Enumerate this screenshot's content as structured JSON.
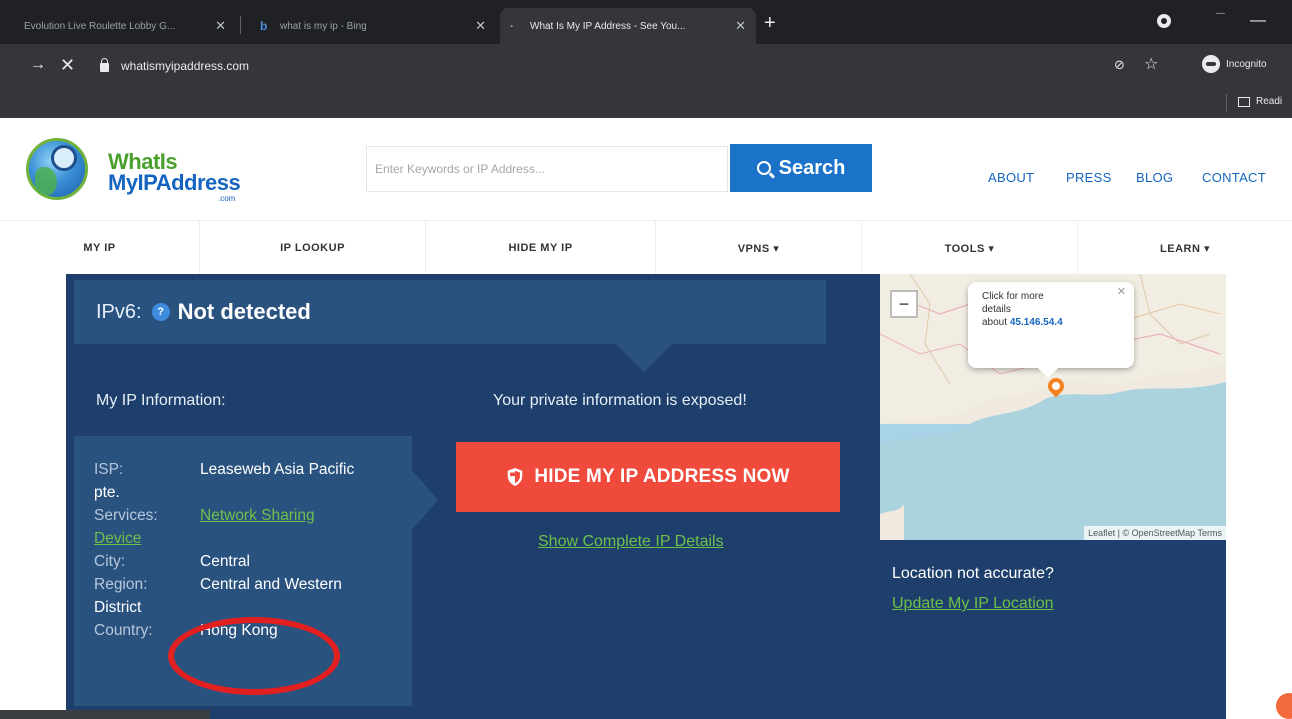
{
  "browser": {
    "tabs": [
      {
        "title": "Evolution Live Roulette Lobby G...",
        "active": false
      },
      {
        "title": "what is my ip - Bing",
        "active": false
      },
      {
        "title": "What Is My IP Address - See You...",
        "active": true
      }
    ],
    "url": "whatismyipaddress.com",
    "profile_label": "Incognito",
    "reading_list": "Readi"
  },
  "site": {
    "logo": {
      "line1": "WhatIs",
      "line2": "MyIPAddress",
      "line3": ".com"
    },
    "search_placeholder": "Enter Keywords or IP Address...",
    "search_button": "Search",
    "top_nav": [
      "ABOUT",
      "PRESS",
      "BLOG",
      "CONTACT"
    ],
    "main_menu": [
      "MY IP",
      "IP LOOKUP",
      "HIDE MY IP",
      "VPNS ▾",
      "TOOLS ▾",
      "LEARN ▾"
    ]
  },
  "main": {
    "ipv6_label": "IPv6:",
    "ipv6_value": "Not detected",
    "info_heading": "My IP Information:",
    "info": {
      "isp_label": "ISP:",
      "isp_value": "Leaseweb Asia Pacific",
      "isp_value2": "pte.",
      "services_label": "Services:",
      "services_value": "Network Sharing",
      "services_value2": "Device",
      "city_label": "City:",
      "city_value": "Central",
      "region_label": "Region:",
      "region_value": "Central and Western",
      "region_value2": "District",
      "country_label": "Country:",
      "country_value": "Hong Kong"
    },
    "exposed_text": "Your private information is exposed!",
    "hide_button": "HIDE MY IP ADDRESS NOW",
    "show_details": "Show Complete IP Details",
    "map": {
      "popup_line1": "Click for more",
      "popup_line2": "details",
      "popup_line3": "about",
      "ip": "45.146.54.4",
      "attribution": "Leaflet | © OpenStreetMap Terms"
    },
    "location_question": "Location not accurate?",
    "update_location": "Update My IP Location"
  },
  "colors": {
    "panel": "#1e3f6b",
    "box": "#2a527f",
    "accent_red": "#f04a3c",
    "link_green": "#6cc04a",
    "brand_blue": "#1a73c8"
  }
}
